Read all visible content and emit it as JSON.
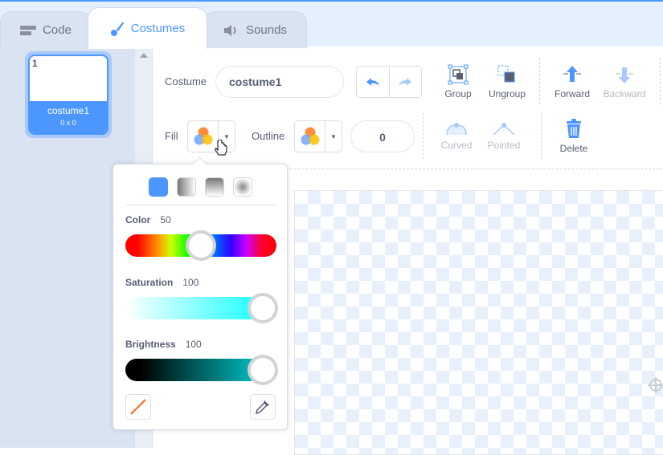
{
  "tabs": [
    {
      "label": "Code",
      "icon": "code-blocks-icon"
    },
    {
      "label": "Costumes",
      "icon": "paintbrush-icon",
      "active": true
    },
    {
      "label": "Sounds",
      "icon": "speaker-icon"
    }
  ],
  "costume_list": [
    {
      "number": "1",
      "name": "costume1",
      "size": "0 x 0",
      "selected": true
    }
  ],
  "toolbar": {
    "costume_label": "Costume",
    "costume_name": "costume1",
    "group": "Group",
    "ungroup": "Ungroup",
    "forward": "Forward",
    "backward": "Backward",
    "fill_label": "Fill",
    "outline_label": "Outline",
    "outline_width": "0",
    "curved": "Curved",
    "pointed": "Pointed",
    "delete": "Delete"
  },
  "fill_popup": {
    "fill_types": [
      "solid",
      "horizontal-gradient",
      "vertical-gradient",
      "radial-gradient"
    ],
    "selected_fill_type": "solid",
    "color_label": "Color",
    "color_value": "50",
    "saturation_label": "Saturation",
    "saturation_value": "100",
    "brightness_label": "Brightness",
    "brightness_value": "100",
    "solid_color": "#4c97ff",
    "current_color": "#00ffff"
  },
  "colors": {
    "accent": "#4c97ff",
    "text": "#575e75"
  }
}
